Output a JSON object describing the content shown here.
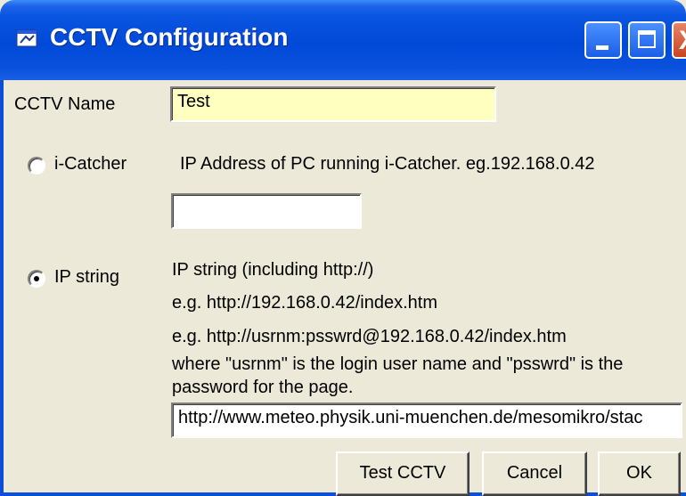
{
  "window": {
    "title": "CCTV Configuration",
    "icon": "camera-app-icon",
    "controls": {
      "minimize": "minimize-icon",
      "maximize": "maximize-icon",
      "close": "close-icon",
      "close_glyph": "X"
    }
  },
  "form": {
    "cctv_name_label": "CCTV Name",
    "cctv_name_value": "Test",
    "icatcher_radio_label": "i-Catcher",
    "icatcher_selected": false,
    "icatcher_hint": "IP Address of PC running i-Catcher. eg.192.168.0.42",
    "icatcher_ip_value": "",
    "ipstring_radio_label": "IP string",
    "ipstring_selected": true,
    "ipstring_hint_1": "IP string (including http://)",
    "ipstring_hint_2": "e.g. http://192.168.0.42/index.htm",
    "ipstring_hint_3": "e.g. http://usrnm:psswrd@192.168.0.42/index.htm",
    "ipstring_hint_4": "where \"usrnm\" is the login user name and \"psswrd\" is the",
    "ipstring_hint_5": "password for the page.",
    "ipstring_value": "http://www.meteo.physik.uni-muenchen.de/mesomikro/stac"
  },
  "buttons": {
    "test": "Test CCTV",
    "cancel": "Cancel",
    "ok": "OK"
  },
  "colors": {
    "titlebar": "#0a55e0",
    "dialog_bg": "#ece9d8",
    "name_field_bg": "#ffffc0"
  }
}
